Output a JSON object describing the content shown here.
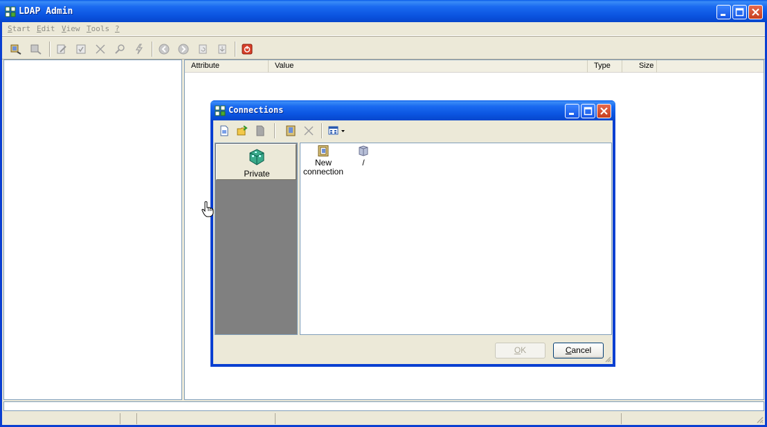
{
  "window": {
    "title": "LDAP Admin"
  },
  "menu": [
    {
      "label": "Start",
      "key": "S",
      "rest": "tart"
    },
    {
      "label": "Edit",
      "key": "E",
      "rest": "dit"
    },
    {
      "label": "View",
      "key": "V",
      "rest": "iew"
    },
    {
      "label": "Tools",
      "key": "T",
      "rest": "ools"
    },
    {
      "label": "?",
      "key": "?",
      "rest": ""
    }
  ],
  "toolbar_icons": [
    "connect-icon",
    "disconnect-icon",
    "edit-entry-icon",
    "save-icon",
    "delete-icon",
    "search-icon",
    "lightning-icon",
    "back-icon",
    "forward-icon",
    "refresh-icon",
    "export-icon",
    "exit-icon"
  ],
  "columns": {
    "attribute": "Attribute",
    "value": "Value",
    "type": "Type",
    "size": "Size"
  },
  "dialog": {
    "title": "Connections",
    "outlook_group": "Private",
    "items": [
      {
        "label_line1": "New",
        "label_line2": "connection"
      },
      {
        "label_line1": "/",
        "label_line2": ""
      }
    ],
    "ok": {
      "key": "O",
      "rest": "K"
    },
    "cancel": {
      "key": "C",
      "rest": "ancel"
    }
  },
  "colors": {
    "titlebar": "#0b54e0",
    "face": "#ece9d8",
    "close": "#c73e1e",
    "outlook_bg": "#808080"
  }
}
